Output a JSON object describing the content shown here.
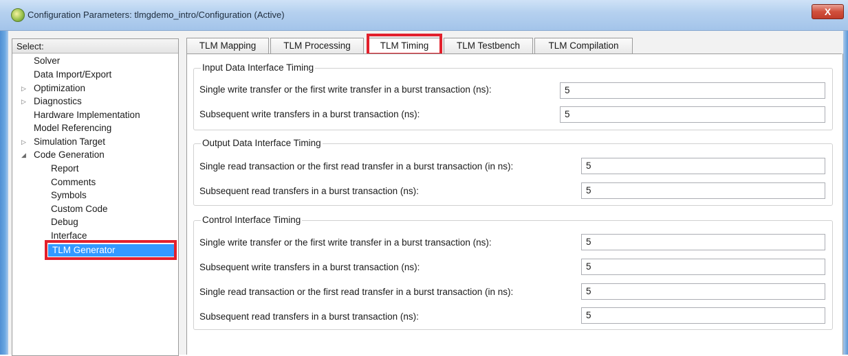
{
  "window": {
    "title": "Configuration Parameters: tlmgdemo_intro/Configuration (Active)",
    "close_label": "X"
  },
  "tree": {
    "header": "Select:",
    "items": [
      {
        "label": "Solver",
        "expandable": false
      },
      {
        "label": "Data Import/Export",
        "expandable": false
      },
      {
        "label": "Optimization",
        "expandable": true,
        "expanded": false
      },
      {
        "label": "Diagnostics",
        "expandable": true,
        "expanded": false
      },
      {
        "label": "Hardware Implementation",
        "expandable": false
      },
      {
        "label": "Model Referencing",
        "expandable": false
      },
      {
        "label": "Simulation Target",
        "expandable": true,
        "expanded": false
      },
      {
        "label": "Code Generation",
        "expandable": true,
        "expanded": true
      },
      {
        "label": "Report",
        "expandable": false
      },
      {
        "label": "Comments",
        "expandable": false
      },
      {
        "label": "Symbols",
        "expandable": false
      },
      {
        "label": "Custom Code",
        "expandable": false
      },
      {
        "label": "Debug",
        "expandable": false
      },
      {
        "label": "Interface",
        "expandable": false
      },
      {
        "label": "TLM Generator",
        "expandable": false,
        "selected": true
      }
    ]
  },
  "tabs": [
    {
      "label": "TLM Mapping",
      "active": false
    },
    {
      "label": "TLM Processing",
      "active": false
    },
    {
      "label": "TLM Timing",
      "active": true
    },
    {
      "label": "TLM Testbench",
      "active": false
    },
    {
      "label": "TLM Compilation",
      "active": false
    }
  ],
  "groups": {
    "input": {
      "title": "Input Data Interface Timing",
      "rows": [
        {
          "label": "Single write transfer or the first write transfer in a burst transaction (ns):",
          "value": "5"
        },
        {
          "label": "Subsequent write transfers in a burst transaction (ns):",
          "value": "5"
        }
      ]
    },
    "output": {
      "title": "Output Data Interface Timing",
      "rows": [
        {
          "label": "Single read transaction or the first read transfer in a burst transaction (in ns):",
          "value": "5"
        },
        {
          "label": "Subsequent read transfers in a burst transaction (ns):",
          "value": "5"
        }
      ]
    },
    "control": {
      "title": "Control Interface Timing",
      "rows": [
        {
          "label": "Single write transfer or the first write transfer in a burst transaction (ns):",
          "value": "5"
        },
        {
          "label": "Subsequent write transfers in a burst transaction (ns):",
          "value": "5"
        },
        {
          "label": "Single read transaction or the first read transfer in a burst transaction (in ns):",
          "value": "5"
        },
        {
          "label": "Subsequent read transfers in a burst transaction (ns):",
          "value": "5"
        }
      ]
    }
  },
  "colors": {
    "highlight": "#e2202c",
    "selection": "#3399ff"
  }
}
